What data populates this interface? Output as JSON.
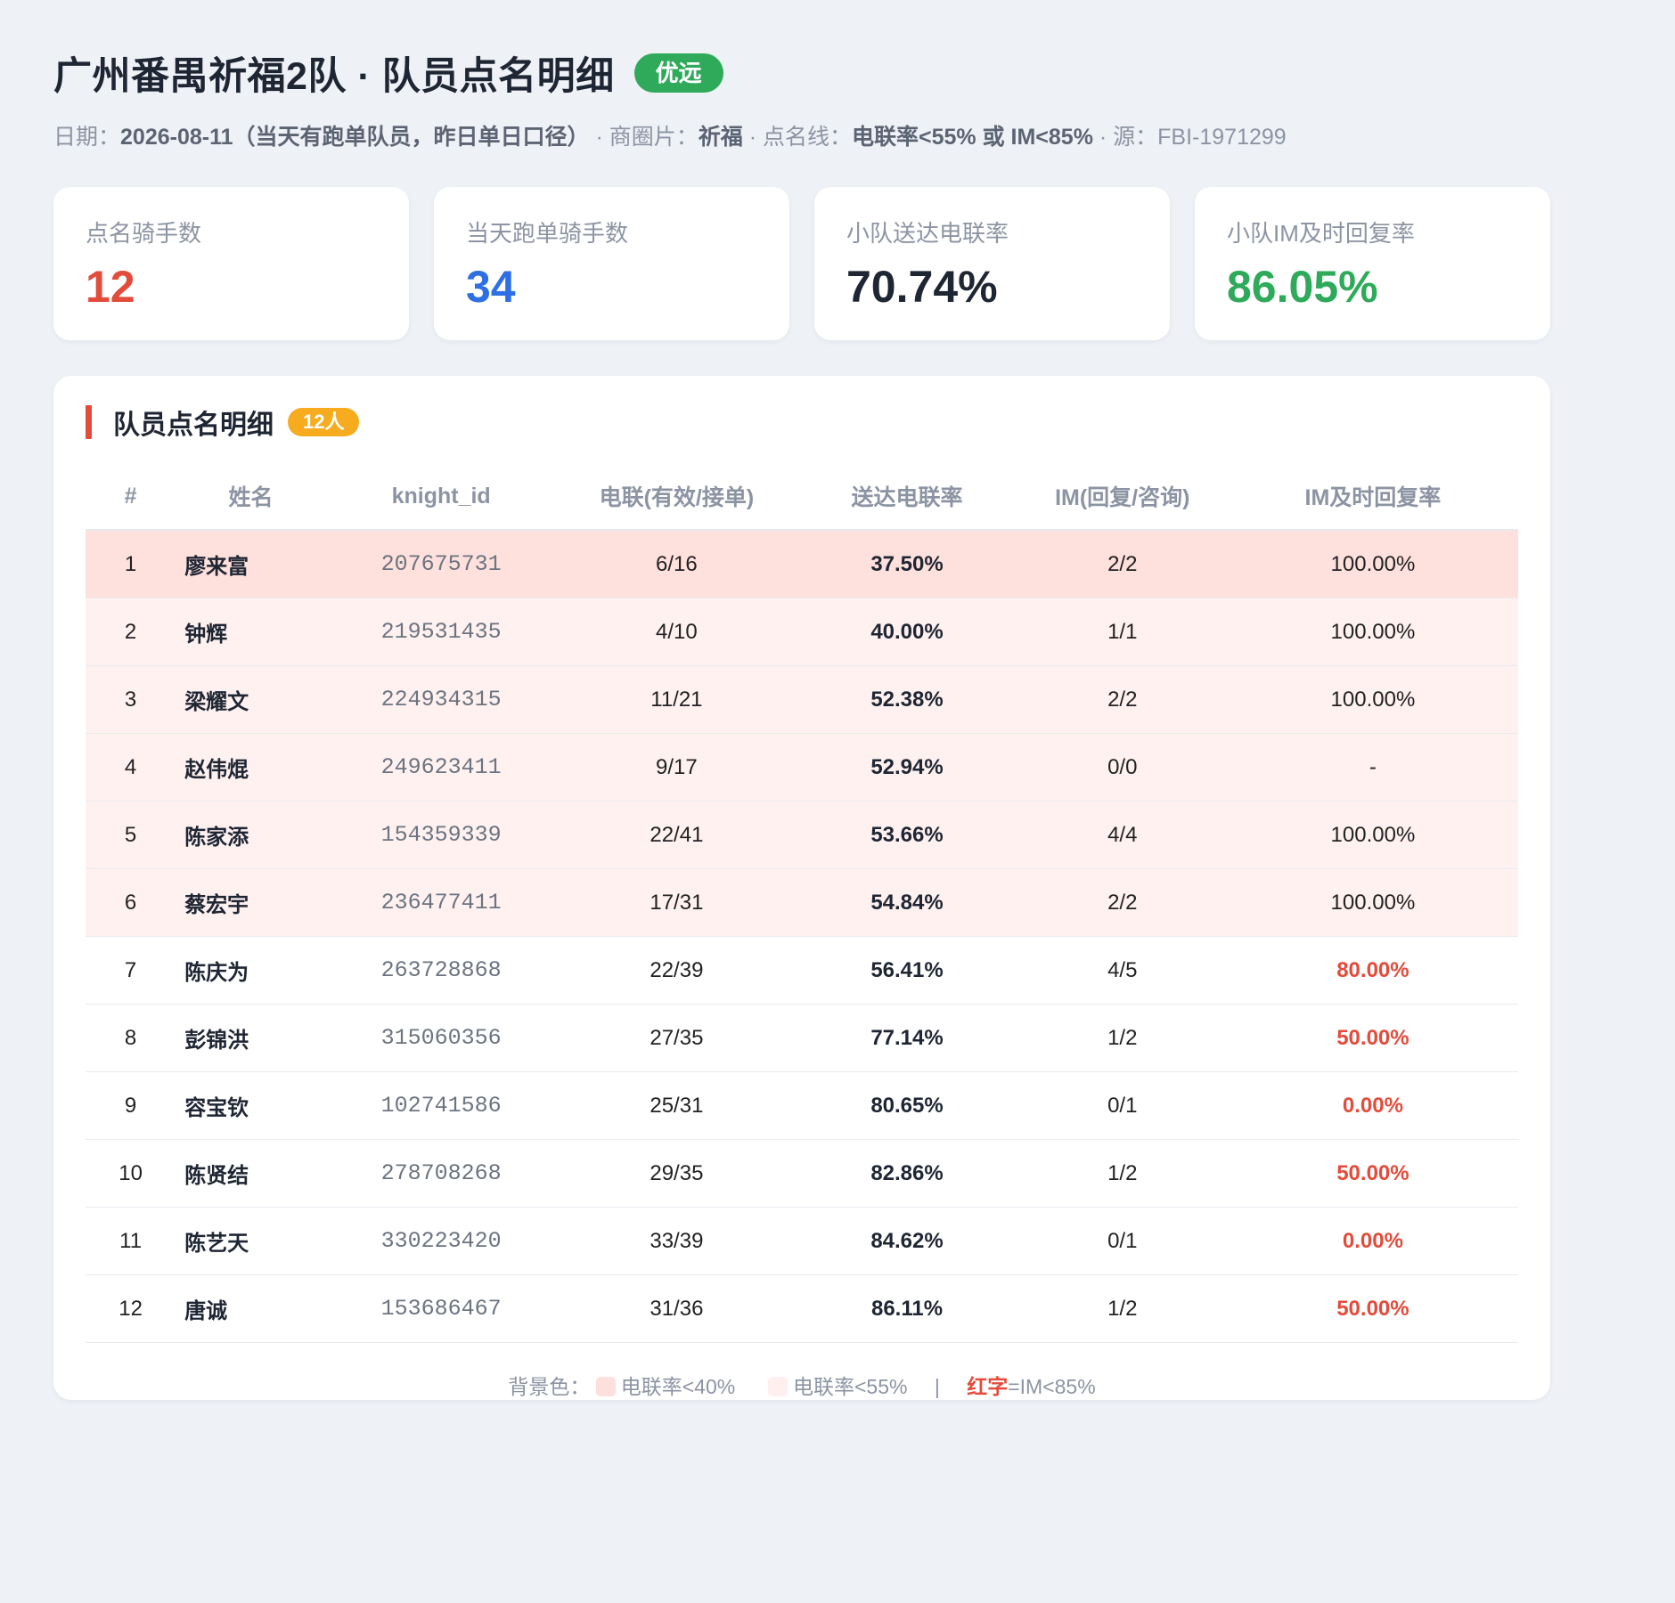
{
  "header": {
    "title": "广州番禺祈福2队 · 队员点名明细",
    "badge": "优远",
    "subtitle": {
      "date_label": "日期：",
      "date_value": "2026-08-11（当天有跑单队员，昨日单日口径）",
      "sep1": " · 商圈片：",
      "area_value": "祈福",
      "sep2": " · 点名线：",
      "line_value": "电联率<55% 或 IM<85%",
      "sep3": " · 源：FBI-1971299"
    }
  },
  "cards": [
    {
      "label": "点名骑手数",
      "value": "12",
      "color": "#e34b3b"
    },
    {
      "label": "当天跑单骑手数",
      "value": "34",
      "color": "#2f6fe4"
    },
    {
      "label": "小队送达电联率",
      "value": "70.74%",
      "color": "#1f2633"
    },
    {
      "label": "小队IM及时回复率",
      "value": "86.05%",
      "color": "#2eaa5a"
    }
  ],
  "panel": {
    "title": "队员点名明细",
    "count_badge": "12人",
    "columns": [
      "#",
      "姓名",
      "knight_id",
      "电联(有效/接单)",
      "送达电联率",
      "IM(回复/咨询)",
      "IM及时回复率"
    ],
    "rows": [
      {
        "no": "1",
        "name": "廖来富",
        "kid": "207675731",
        "call": "6/16",
        "rate": "37.50%",
        "im": "2/2",
        "im_rate": "100.00%",
        "bg": "strong",
        "im_red": false
      },
      {
        "no": "2",
        "name": "钟辉",
        "kid": "219531435",
        "call": "4/10",
        "rate": "40.00%",
        "im": "1/1",
        "im_rate": "100.00%",
        "bg": "soft",
        "im_red": false
      },
      {
        "no": "3",
        "name": "梁耀文",
        "kid": "224934315",
        "call": "11/21",
        "rate": "52.38%",
        "im": "2/2",
        "im_rate": "100.00%",
        "bg": "soft",
        "im_red": false
      },
      {
        "no": "4",
        "name": "赵伟焜",
        "kid": "249623411",
        "call": "9/17",
        "rate": "52.94%",
        "im": "0/0",
        "im_rate": "-",
        "bg": "soft",
        "im_red": false
      },
      {
        "no": "5",
        "name": "陈家添",
        "kid": "154359339",
        "call": "22/41",
        "rate": "53.66%",
        "im": "4/4",
        "im_rate": "100.00%",
        "bg": "soft",
        "im_red": false
      },
      {
        "no": "6",
        "name": "蔡宏宇",
        "kid": "236477411",
        "call": "17/31",
        "rate": "54.84%",
        "im": "2/2",
        "im_rate": "100.00%",
        "bg": "soft",
        "im_red": false
      },
      {
        "no": "7",
        "name": "陈庆为",
        "kid": "263728868",
        "call": "22/39",
        "rate": "56.41%",
        "im": "4/5",
        "im_rate": "80.00%",
        "bg": "none",
        "im_red": true
      },
      {
        "no": "8",
        "name": "彭锦洪",
        "kid": "315060356",
        "call": "27/35",
        "rate": "77.14%",
        "im": "1/2",
        "im_rate": "50.00%",
        "bg": "none",
        "im_red": true
      },
      {
        "no": "9",
        "name": "容宝钦",
        "kid": "102741586",
        "call": "25/31",
        "rate": "80.65%",
        "im": "0/1",
        "im_rate": "0.00%",
        "bg": "none",
        "im_red": true
      },
      {
        "no": "10",
        "name": "陈贤结",
        "kid": "278708268",
        "call": "29/35",
        "rate": "82.86%",
        "im": "1/2",
        "im_rate": "50.00%",
        "bg": "none",
        "im_red": true
      },
      {
        "no": "11",
        "name": "陈艺天",
        "kid": "330223420",
        "call": "33/39",
        "rate": "84.62%",
        "im": "0/1",
        "im_rate": "0.00%",
        "bg": "none",
        "im_red": true
      },
      {
        "no": "12",
        "name": "唐诚",
        "kid": "153686467",
        "call": "31/36",
        "rate": "86.11%",
        "im": "1/2",
        "im_rate": "50.00%",
        "bg": "none",
        "im_red": true
      }
    ]
  },
  "legend": {
    "prefix": "背景色：",
    "strong": "电联率<40%",
    "soft": "电联率<55%",
    "divider": "|",
    "red_word": "红字",
    "red_rest": "=IM<85%"
  },
  "colors": {
    "red": "#e34b3b",
    "blue": "#2f6fe4",
    "green": "#2eaa5a",
    "orange": "#f7ab1e",
    "row_strong": "#fee0dc",
    "row_soft": "#fff1f0"
  }
}
